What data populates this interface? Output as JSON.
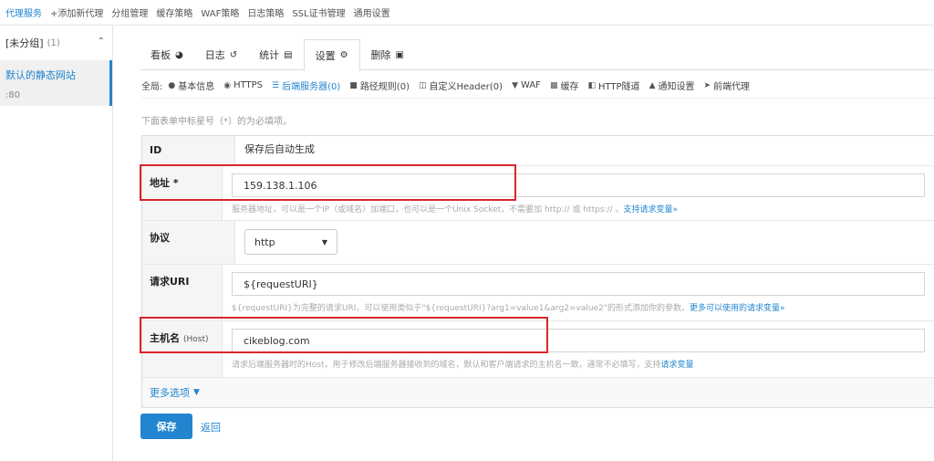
{
  "topnav": {
    "items": [
      "代理服务",
      "+添加新代理",
      "分组管理",
      "缓存策略",
      "WAF策略",
      "日志策略",
      "SSL证书管理",
      "通用设置"
    ]
  },
  "sidebar": {
    "group_name": "[未分组]",
    "group_count": "(1)",
    "site_title": "默认的静态网站",
    "site_port": ":80"
  },
  "tabs": [
    {
      "label": "看板",
      "icon": "dashboard-icon"
    },
    {
      "label": "日志",
      "icon": "history-icon"
    },
    {
      "label": "统计",
      "icon": "chart-icon"
    },
    {
      "label": "设置",
      "icon": "gear-icon"
    },
    {
      "label": "删除",
      "icon": "trash-icon"
    }
  ],
  "submenu": {
    "label": "全局:",
    "items": [
      {
        "label": "基本信息",
        "icon": "info-icon"
      },
      {
        "label": "HTTPS",
        "icon": "lock-circle-icon"
      },
      {
        "label": "后端服务器(0)",
        "icon": "server-icon"
      },
      {
        "label": "路径规则(0)",
        "icon": "folder-icon"
      },
      {
        "label": "自定义Header(0)",
        "icon": "file-icon"
      },
      {
        "label": "WAF",
        "icon": "filter-icon"
      },
      {
        "label": "缓存",
        "icon": "save-icon"
      },
      {
        "label": "HTTP隧道",
        "icon": "tunnel-icon"
      },
      {
        "label": "通知设置",
        "icon": "bell-icon"
      },
      {
        "label": "前端代理",
        "icon": "send-icon"
      }
    ]
  },
  "hint": "下面表单中标星号（*）的为必填项。",
  "form": {
    "id_label": "ID",
    "id_value": "保存后自动生成",
    "address_label": "地址 *",
    "address_value": "159.138.1.106",
    "address_help": "服务器地址，可以是一个IP（或域名）加端口，也可以是一个Unix Socket，不需要加 http:// 或 https:// 。",
    "address_help_link": "支持请求变量»",
    "protocol_label": "协议",
    "protocol_value": "http",
    "uri_label": "请求URI",
    "uri_value": "${requestURI}",
    "uri_help": "${requestURI}为完整的请求URI，可以使用类似于\"${requestURI}?arg1=value1&arg2=value2\"的形式添加你的参数。",
    "uri_help_link": "更多可以使用的请求变量»",
    "host_label": "主机名",
    "host_label_sub": "(Host)",
    "host_value": "cikeblog.com",
    "host_help": "请求后端服务器时的Host，用于修改后端服务器接收到的域名，默认和客户端请求的主机名一致，通常不必填写，支持",
    "host_help_link": "请求变量",
    "more_options": "更多选项"
  },
  "actions": {
    "save": "保存",
    "back": "返回"
  },
  "colors": {
    "accent": "#2185d0",
    "highlight": "#d9262c"
  }
}
